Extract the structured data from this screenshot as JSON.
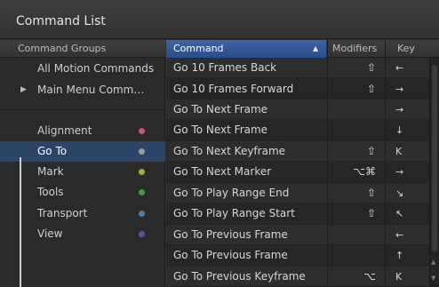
{
  "window": {
    "title": "Command List"
  },
  "groups": {
    "header": "Command Groups",
    "items": [
      {
        "label": "All Motion Commands"
      },
      {
        "label": "Main Menu Comm…",
        "expander": "▶"
      },
      {
        "label": "Alignment",
        "color": "#c05a6a"
      },
      {
        "label": "Go To",
        "color": "#9a9a9a",
        "selected": true
      },
      {
        "label": "Mark",
        "color": "#a8a83c"
      },
      {
        "label": "Tools",
        "color": "#3e9a4e"
      },
      {
        "label": "Transport",
        "color": "#4a7fa8"
      },
      {
        "label": "View",
        "color": "#5a52a0"
      }
    ]
  },
  "commands": {
    "headers": {
      "command": "Command",
      "sort_indicator": "▲",
      "modifiers": "Modifiers",
      "key": "Key"
    },
    "rows": [
      {
        "name": "Go 10 Frames Back",
        "modifiers": "⇧",
        "key": "←"
      },
      {
        "name": "Go 10 Frames Forward",
        "modifiers": "⇧",
        "key": "→"
      },
      {
        "name": "Go To Next Frame",
        "modifiers": "",
        "key": "→"
      },
      {
        "name": "Go To Next Frame",
        "modifiers": "",
        "key": "↓"
      },
      {
        "name": "Go To Next Keyframe",
        "modifiers": "⇧",
        "key": "K"
      },
      {
        "name": "Go To Next Marker",
        "modifiers": "⌥⌘",
        "key": "→"
      },
      {
        "name": "Go To Play Range End",
        "modifiers": "⇧",
        "key": "↘"
      },
      {
        "name": "Go To Play Range Start",
        "modifiers": "⇧",
        "key": "↖"
      },
      {
        "name": "Go To Previous Frame",
        "modifiers": "",
        "key": "←"
      },
      {
        "name": "Go To Previous Frame",
        "modifiers": "",
        "key": "↑"
      },
      {
        "name": "Go To Previous Keyframe",
        "modifiers": "⌥",
        "key": "K"
      }
    ]
  }
}
